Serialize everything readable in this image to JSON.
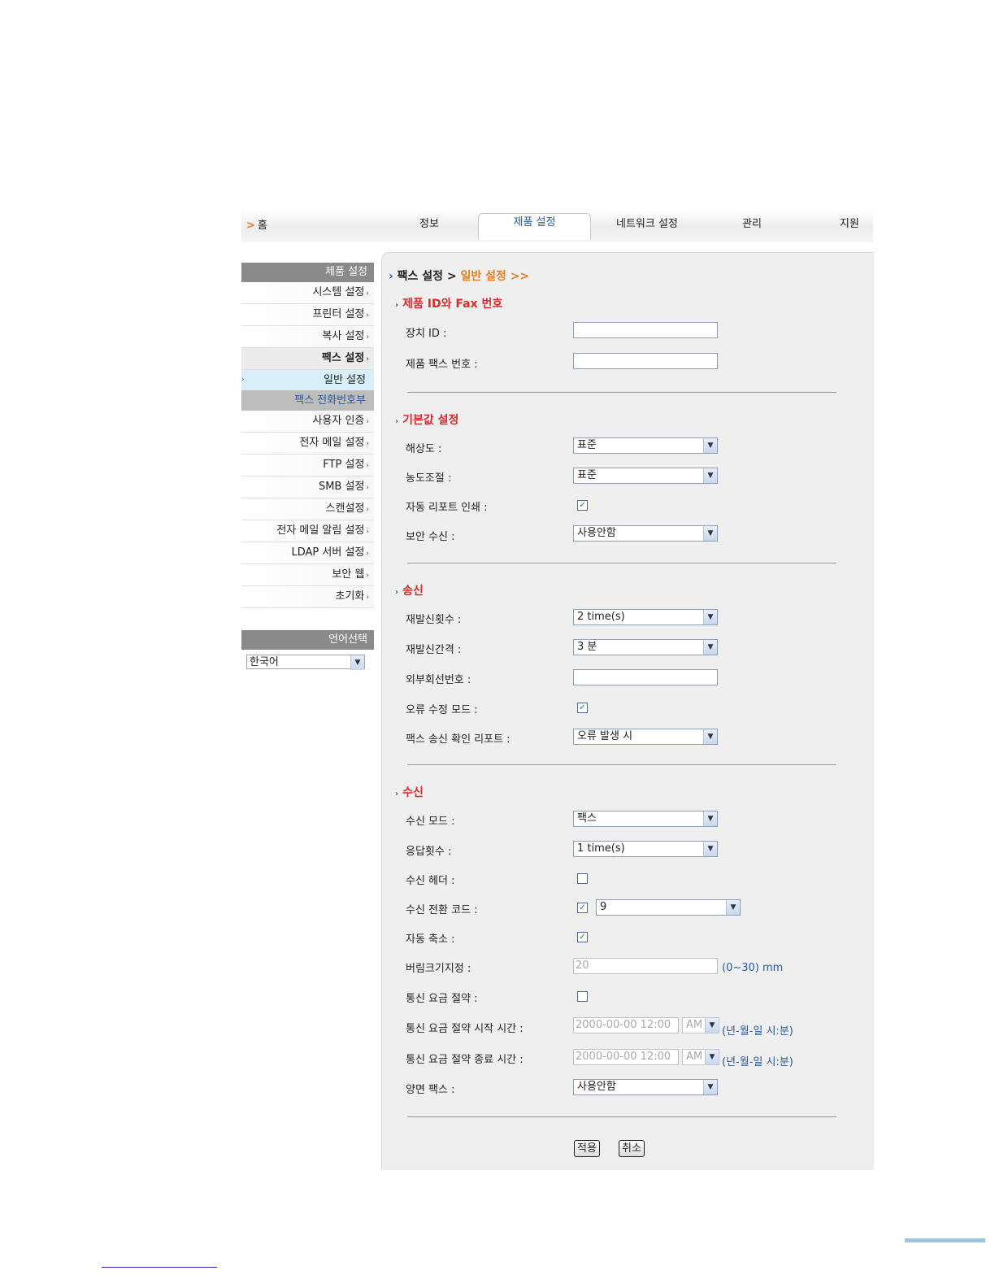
{
  "nav": {
    "home": "홈",
    "items": [
      "정보",
      "제품 설정",
      "네트워크 설정",
      "관리",
      "지원"
    ],
    "active": "제품 설정"
  },
  "sidebar": {
    "header": "제품 설정",
    "items": [
      "시스템 설정",
      "프린터 설정",
      "복사 설정",
      "팩스 설정"
    ],
    "sub_items": [
      "일반 설정",
      "팩스 전화번호부"
    ],
    "items2": [
      "사용자 인증",
      "전자 메일 설정",
      "FTP 설정",
      "SMB 설정",
      "스캔설정",
      "전자 메일 알림 설정",
      "LDAP 서버 설정",
      "보안 웹",
      "초기화"
    ]
  },
  "language": {
    "header": "언어선택",
    "selected": "한국어"
  },
  "breadcrumb": {
    "parent": "팩스 설정",
    "sep": ">",
    "current": "일반 설정 >>"
  },
  "sections": {
    "id": {
      "title": "제품 ID와 Fax 번호",
      "device_id_label": "장치 ID :",
      "fax_number_label": "제품 팩스 번호 :"
    },
    "defaults": {
      "title": "기본값 설정",
      "resolution_label": "해상도 :",
      "resolution_value": "표준",
      "darkness_label": "농도조절 :",
      "darkness_value": "표준",
      "auto_report_label": "자동 리포트 인쇄 :",
      "secure_rx_label": "보안 수신 :",
      "secure_rx_value": "사용안함"
    },
    "send": {
      "title": "송신",
      "redial_times_label": "재발신횟수 :",
      "redial_times_value": "2 time(s)",
      "redial_interval_label": "재발신간격 :",
      "redial_interval_value": "3 분",
      "prefix_label": "외부회선번호 :",
      "ecm_label": "오류 수정 모드 :",
      "confirm_label": "팩스 송신 확인 리포트 :",
      "confirm_value": "오류 발생 시"
    },
    "receive": {
      "title": "수신",
      "mode_label": "수신 모드 :",
      "mode_value": "팩스",
      "rings_label": "응답횟수 :",
      "rings_value": "1 time(s)",
      "header_label": "수신 헤더 :",
      "code_label": "수신 전환 코드 :",
      "code_value": "9",
      "reduce_label": "자동 축소 :",
      "discard_label": "버림크기지정 :",
      "discard_value": "20",
      "discard_hint": "(0~30) mm",
      "toll_label": "통신 요금 절약 :",
      "toll_start_label": "통신 요금 절약 시작 시간 :",
      "toll_start_value": "2000-00-00 12:00",
      "toll_start_ampm": "AM",
      "toll_end_label": "통신 요금 절약 종료 시간 :",
      "toll_end_value": "2000-00-00 12:00",
      "toll_end_ampm": "AM",
      "time_hint": "(년-월-일 시:분)",
      "duplex_label": "양면 팩스 :",
      "duplex_value": "사용안함"
    }
  },
  "buttons": {
    "apply": "적용",
    "cancel": "취소"
  },
  "checkboxes": {
    "auto_report": true,
    "ecm": true,
    "rx_header": false,
    "rx_code": true,
    "auto_reduce": true,
    "toll_save": false
  },
  "icons": {
    "check": "checkmark-icon",
    "dropdown": "dropdown-arrow-icon",
    "chevron": "chevron-right-icon"
  },
  "colors": {
    "accent": "#e67e22",
    "section": "#d92b2b",
    "link": "#2a5a9e"
  }
}
